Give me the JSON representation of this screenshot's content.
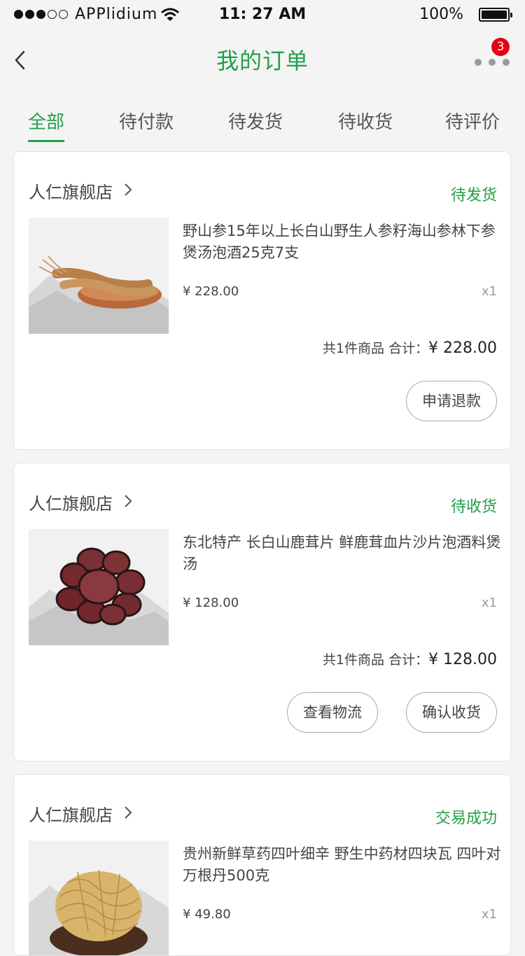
{
  "status_bar": {
    "carrier": "APPlidium",
    "time": "11: 27 AM",
    "battery": "100%"
  },
  "nav": {
    "title": "我的订单",
    "more_badge": "3",
    "icons": {
      "back": "chevron-left-icon",
      "more": "more-dots-icon"
    }
  },
  "tabs": [
    {
      "label": "全部",
      "active": true
    },
    {
      "label": "待付款"
    },
    {
      "label": "待发货"
    },
    {
      "label": "待收货"
    },
    {
      "label": "待评价"
    }
  ],
  "orders": [
    {
      "shop": "人仁旗舰店",
      "status": "待发货",
      "product": "野山参15年以上长白山野生人参籽海山参林下参煲汤泡酒25克7支",
      "price": "¥ 228.00",
      "qty": "x1",
      "count_text": "共1件商品",
      "total_label": "合计：",
      "total": "¥ 228.00",
      "buttons": [
        "申请退款"
      ]
    },
    {
      "shop": "人仁旗舰店",
      "status": "待收货",
      "product": "东北特产 长白山鹿茸片 鲜鹿茸血片沙片泡酒料煲汤",
      "price": "¥ 128.00",
      "qty": "x1",
      "count_text": "共1件商品",
      "total_label": "合计：",
      "total": "¥ 128.00",
      "buttons": [
        "查看物流",
        "确认收货"
      ]
    },
    {
      "shop": "人仁旗舰店",
      "status": "交易成功",
      "product": "贵州新鲜草药四叶细辛 野生中药材四块瓦 四叶对 万根丹500克",
      "price": "¥ 49.80",
      "qty": "x1"
    }
  ],
  "colors": {
    "accent": "#22a04a",
    "badge": "#e60012",
    "background": "#f4f4f4"
  }
}
